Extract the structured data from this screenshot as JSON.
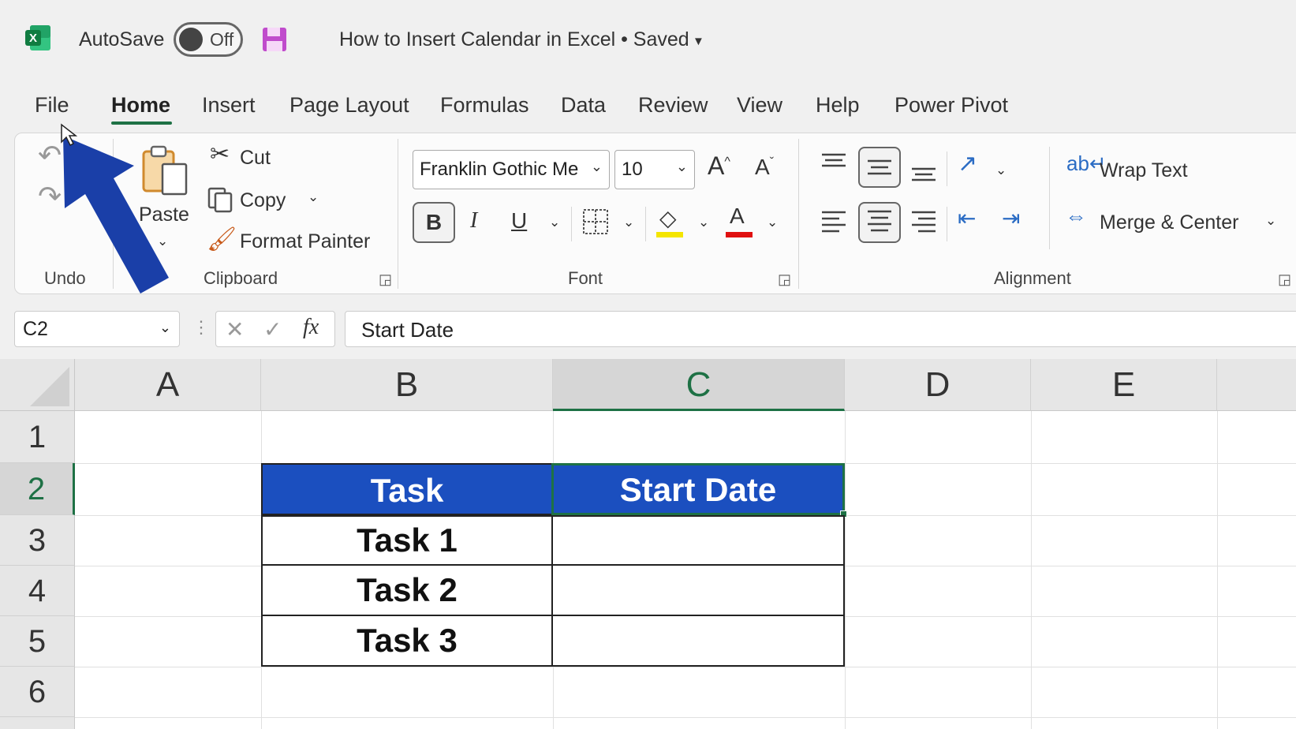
{
  "titlebar": {
    "autosave_label": "AutoSave",
    "autosave_state": "Off",
    "document_title": "How to Insert Calendar in Excel • Saved"
  },
  "menu": {
    "tabs": [
      "File",
      "Home",
      "Insert",
      "Page Layout",
      "Formulas",
      "Data",
      "Review",
      "View",
      "Help",
      "Power Pivot"
    ],
    "active": "Home"
  },
  "ribbon": {
    "undo_group": "Undo",
    "clipboard": {
      "label": "Clipboard",
      "paste": "Paste",
      "cut": "Cut",
      "copy": "Copy",
      "format_painter": "Format Painter"
    },
    "font": {
      "label": "Font",
      "font_name": "Franklin Gothic Me",
      "font_size": "10",
      "bold": "B",
      "italic": "I",
      "underline": "U"
    },
    "alignment": {
      "label": "Alignment",
      "wrap_text": "Wrap Text",
      "merge_center": "Merge & Center"
    }
  },
  "formula_bar": {
    "name_box": "C2",
    "fx": "fx",
    "content": "Start Date"
  },
  "sheet": {
    "columns": [
      "A",
      "B",
      "C",
      "D",
      "E"
    ],
    "rows": [
      "1",
      "2",
      "3",
      "4",
      "5",
      "6"
    ],
    "selected_cell": "C2",
    "table": {
      "headers": [
        "Task",
        "Start Date"
      ],
      "rows": [
        [
          "Task 1",
          ""
        ],
        [
          "Task 2",
          ""
        ],
        [
          "Task 3",
          ""
        ]
      ]
    }
  },
  "colors": {
    "excel_green": "#1e7145",
    "header_fill": "#1b4fbf",
    "annotation_arrow": "#1a3fa8",
    "highlight_yellow": "#f4e500",
    "font_red": "#e01010"
  }
}
